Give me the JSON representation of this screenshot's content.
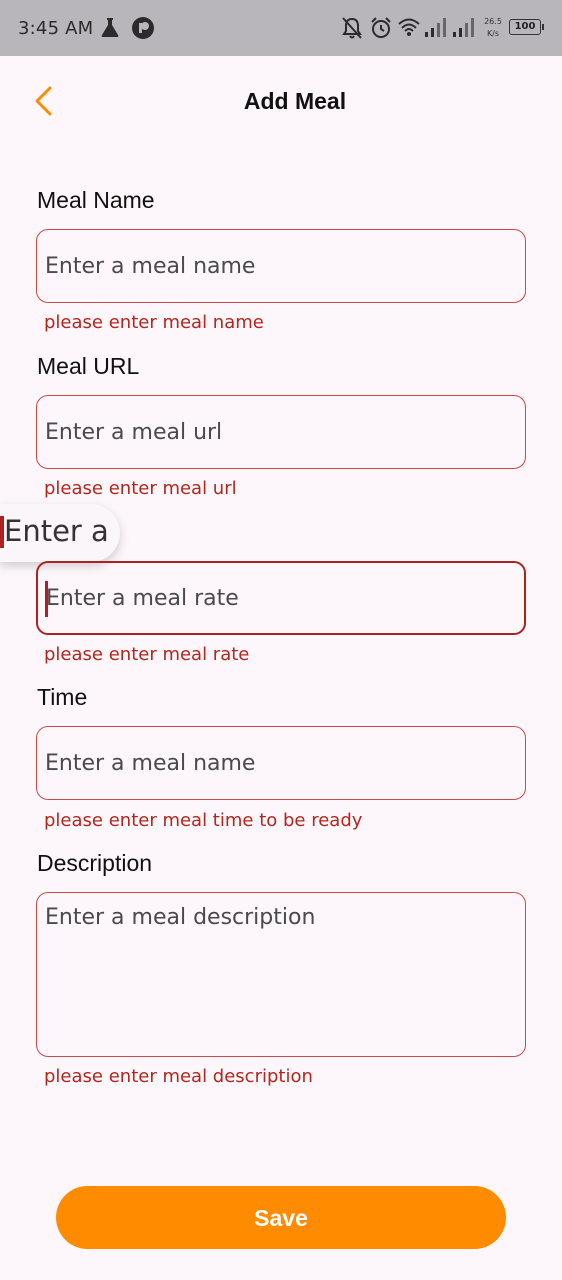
{
  "status_bar": {
    "time": "3:45 AM",
    "network_speed": "26.5",
    "network_unit": "K/s",
    "battery": "100"
  },
  "header": {
    "title": "Add Meal",
    "accent_color": "#ff8c00"
  },
  "form": {
    "meal_name": {
      "label": "Meal Name",
      "placeholder": "Enter a meal name",
      "error": "please enter meal name"
    },
    "meal_url": {
      "label": "Meal URL",
      "placeholder": "Enter a meal url",
      "error": "please enter meal url"
    },
    "meal_rate": {
      "placeholder": "Enter a meal rate",
      "error": "please enter meal rate",
      "magnifier_text": "Enter a r"
    },
    "time": {
      "label": "Time",
      "placeholder": "Enter a meal name",
      "error": "please enter meal time to be ready"
    },
    "description": {
      "label": "Description",
      "placeholder": "Enter a meal description",
      "error": "please enter meal description"
    }
  },
  "actions": {
    "save_label": "Save"
  },
  "colors": {
    "error": "#b3261e",
    "focused_border": "#ad2125",
    "background": "#fdf7fb"
  }
}
